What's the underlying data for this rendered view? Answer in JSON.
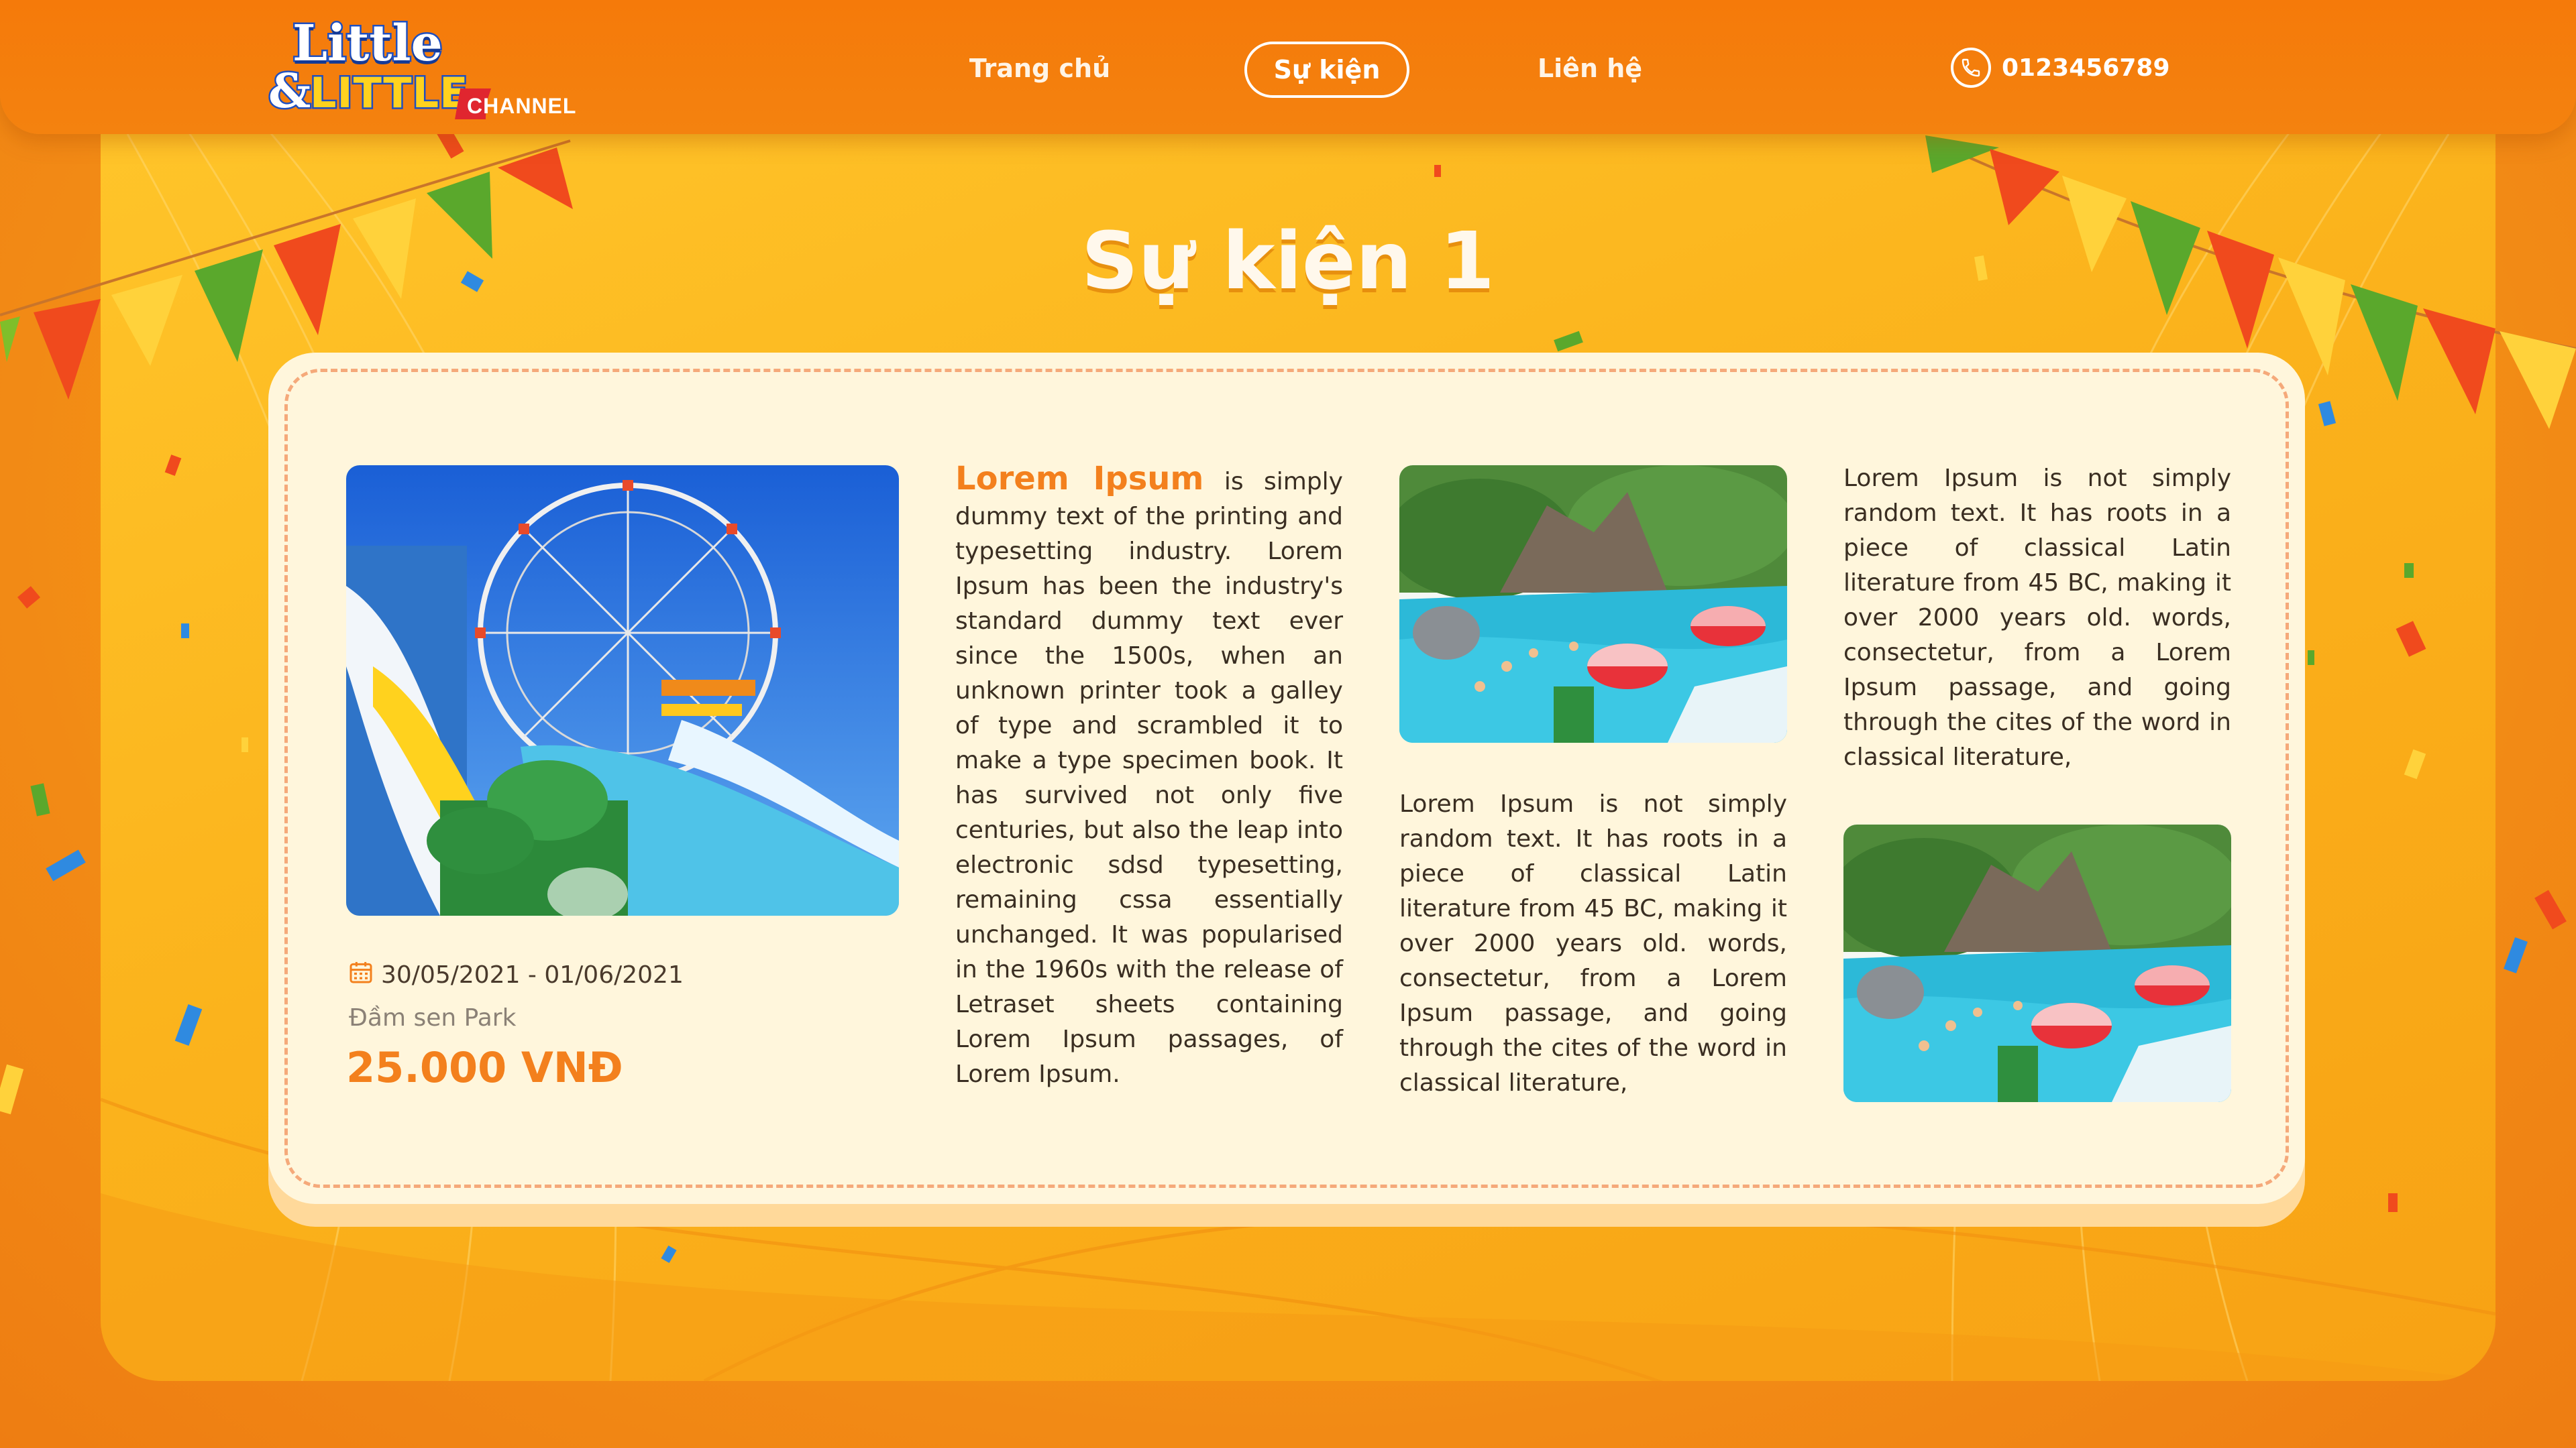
{
  "brand": {
    "logo_line1": "Little",
    "logo_amp": "&",
    "logo_line2": "LITTLE",
    "logo_channel": "CHANNEL"
  },
  "nav": {
    "home": "Trang chủ",
    "events": "Sự kiện",
    "contact": "Liên hệ",
    "phone": "0123456789"
  },
  "page": {
    "title": "Sự kiện 1"
  },
  "event": {
    "date_range": "30/05/2021 - 01/06/2021",
    "location": "Đầm sen Park",
    "price": "25.000 VNĐ"
  },
  "columns": {
    "col1_lead": "Lorem Ipsum",
    "col1_body": " is simply dummy text of the printing and typesetting industry. Lorem Ipsum has been the industry's standard dummy text ever since the 1500s, when an unknown printer took a galley of type and scrambled it to make a type specimen book. It has survived not only five centuries, but also the leap into electronic sdsd typesetting, remaining cssa essentially unchanged. It was popularised in the 1960s with the release of Letraset sheets containing Lorem Ipsum passages, of Lorem Ipsum.",
    "col2_body": "Lorem Ipsum is not simply random text. It has roots in a piece of classical Latin literature from 45 BC, making it over 2000 years old. words, consectetur, from a Lorem Ipsum passage, and going through the cites of the word in classical literature,",
    "col3_body": "Lorem Ipsum is not simply random text. It has roots in a piece of classical Latin literature from 45 BC, making it over 2000 years old. words, consectetur, from a Lorem Ipsum passage, and going through the cites of the word in classical literature,"
  },
  "theme": {
    "header": "#f57a0a",
    "accent": "#f3801d",
    "card": "#fff6dc",
    "stage": "#ffc52a"
  },
  "icons": [
    "phone-icon",
    "calendar-icon"
  ]
}
